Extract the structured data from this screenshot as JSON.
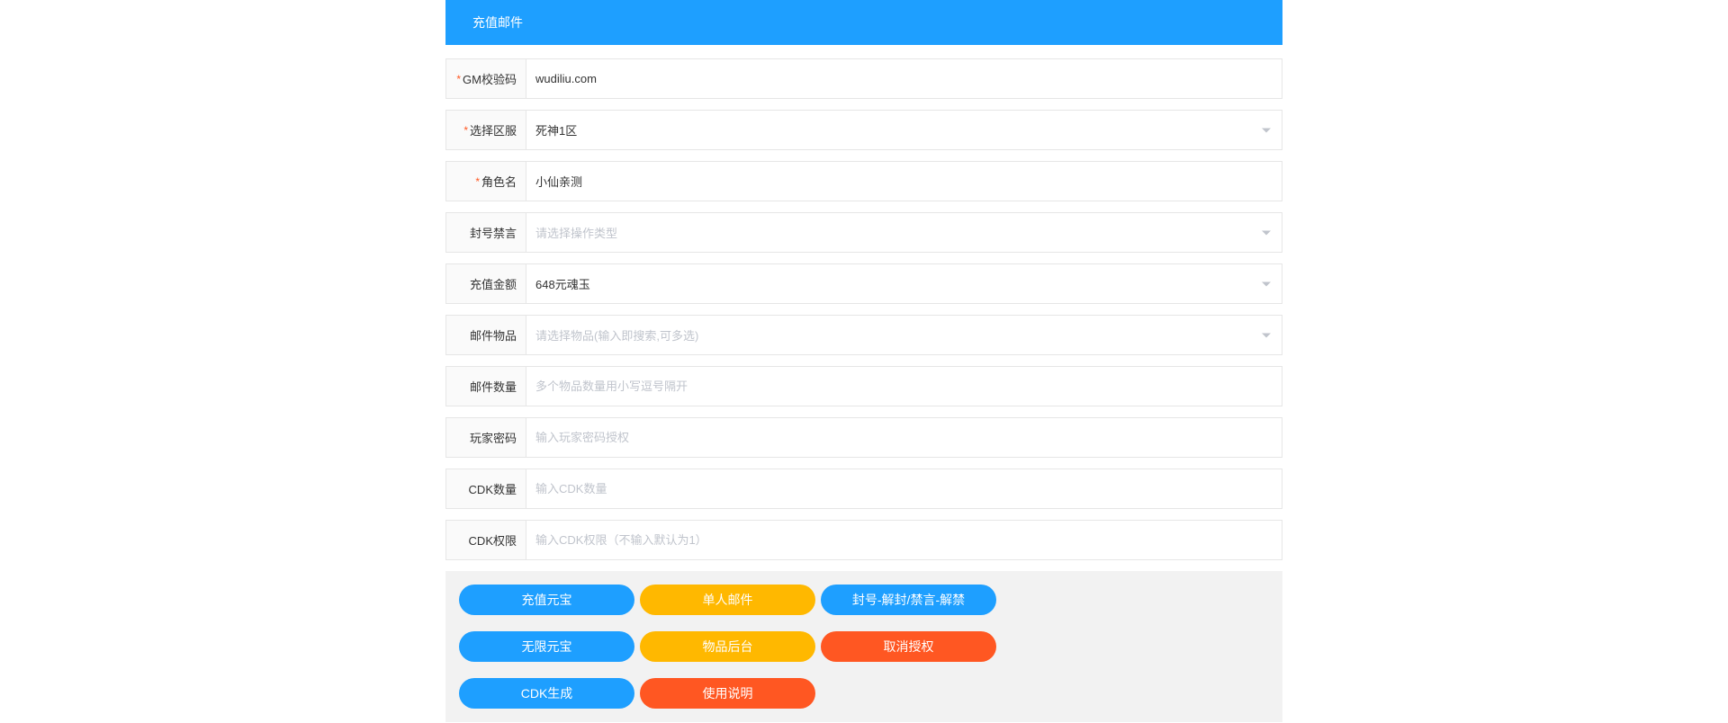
{
  "header": {
    "title": "充值邮件"
  },
  "form": {
    "gm_code": {
      "label": "GM校验码",
      "required": true,
      "value": "wudiliu.com"
    },
    "server": {
      "label": "选择区服",
      "required": true,
      "value": "死神1区"
    },
    "role_name": {
      "label": "角色名",
      "required": true,
      "value": "小仙亲测"
    },
    "ban": {
      "label": "封号禁言",
      "placeholder": "请选择操作类型"
    },
    "recharge": {
      "label": "充值金额",
      "value": "648元魂玉"
    },
    "mail_items": {
      "label": "邮件物品",
      "placeholder": "请选择物品(输入即搜索,可多选)"
    },
    "mail_qty": {
      "label": "邮件数量",
      "placeholder": "多个物品数量用小写逗号隔开"
    },
    "player_pwd": {
      "label": "玩家密码",
      "placeholder": "输入玩家密码授权"
    },
    "cdk_qty": {
      "label": "CDK数量",
      "placeholder": "输入CDK数量"
    },
    "cdk_perm": {
      "label": "CDK权限",
      "placeholder": "输入CDK权限（不输入默认为1）"
    }
  },
  "buttons": {
    "recharge_yuanbao": "充值元宝",
    "single_mail": "单人邮件",
    "ban_unban": "封号-解封/禁言-解禁",
    "unlimited_yuanbao": "无限元宝",
    "item_backend": "物品后台",
    "cancel_auth": "取消授权",
    "cdk_gen": "CDK生成",
    "instructions": "使用说明"
  }
}
